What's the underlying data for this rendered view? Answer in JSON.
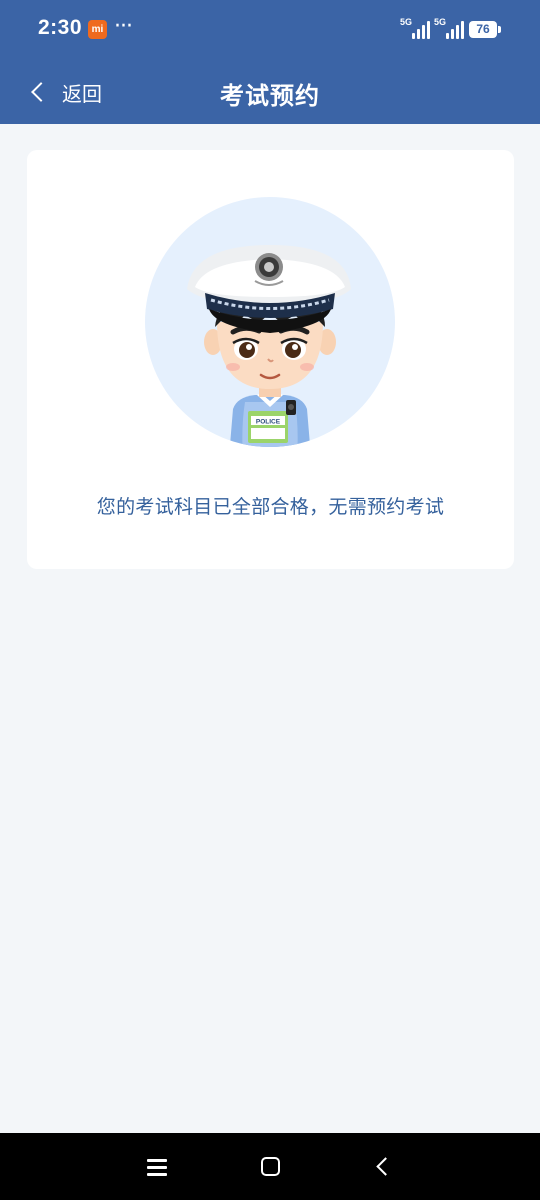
{
  "status_bar": {
    "time": "2:30",
    "app_badge": "mi",
    "more": "···",
    "signal_1_label": "5G",
    "signal_2_label": "5G",
    "battery": "76"
  },
  "nav": {
    "back_label": "返回",
    "title": "考试预约"
  },
  "content": {
    "avatar_badge": "POLICE",
    "message": "您的考试科目已全部合格，无需预约考试"
  },
  "colors": {
    "header": "#3b64a6",
    "page_bg": "#f3f6f9",
    "message_text": "#35619c",
    "avatar_circle": "#e5f0fd"
  },
  "icons": {
    "back": "chevron-left-icon",
    "menu": "menu-icon",
    "home": "home-icon",
    "system_back": "back-icon"
  }
}
